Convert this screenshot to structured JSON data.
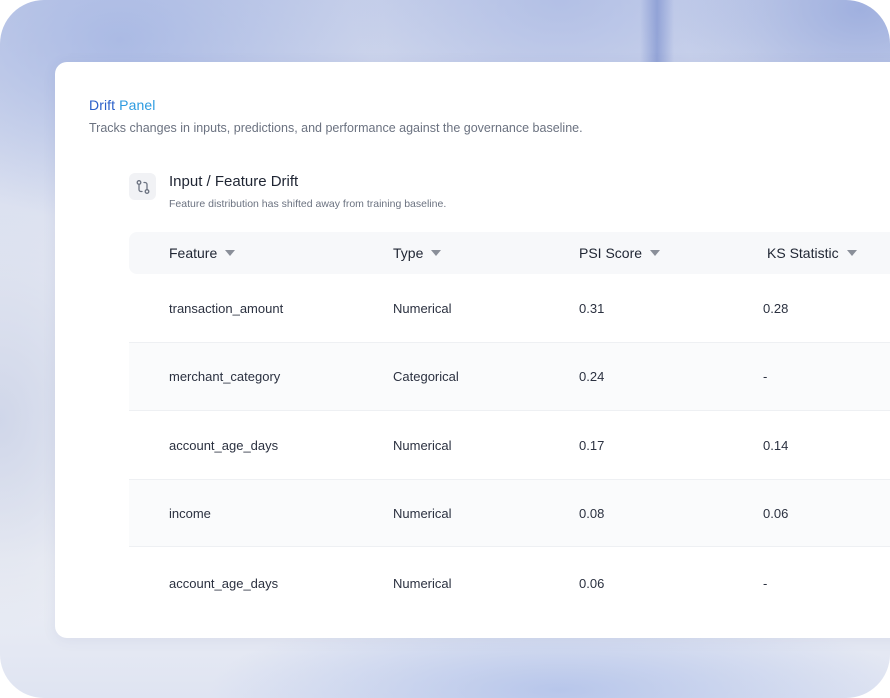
{
  "panel": {
    "title_word1": "Drift",
    "title_word2": "Panel",
    "description": "Tracks changes in inputs, predictions, and performance against the governance baseline."
  },
  "section": {
    "icon": "git-compare-icon",
    "title": "Input / Feature Drift",
    "subtitle": "Feature distribution has shifted away from training baseline."
  },
  "table": {
    "columns": [
      "Feature",
      "Type",
      "PSI Score",
      "KS Statistic"
    ],
    "rows": [
      {
        "feature": "transaction_amount",
        "type": "Numerical",
        "psi": "0.31",
        "ks": "0.28"
      },
      {
        "feature": "merchant_category",
        "type": "Categorical",
        "psi": "0.24",
        "ks": "-"
      },
      {
        "feature": "account_age_days",
        "type": "Numerical",
        "psi": "0.17",
        "ks": "0.14"
      },
      {
        "feature": "income",
        "type": "Numerical",
        "psi": "0.08",
        "ks": "0.06"
      },
      {
        "feature": "account_age_days",
        "type": "Numerical",
        "psi": "0.06",
        "ks": "-"
      }
    ]
  },
  "colors": {
    "title_primary": "#2a5fc9",
    "title_secondary": "#2d9be0"
  }
}
